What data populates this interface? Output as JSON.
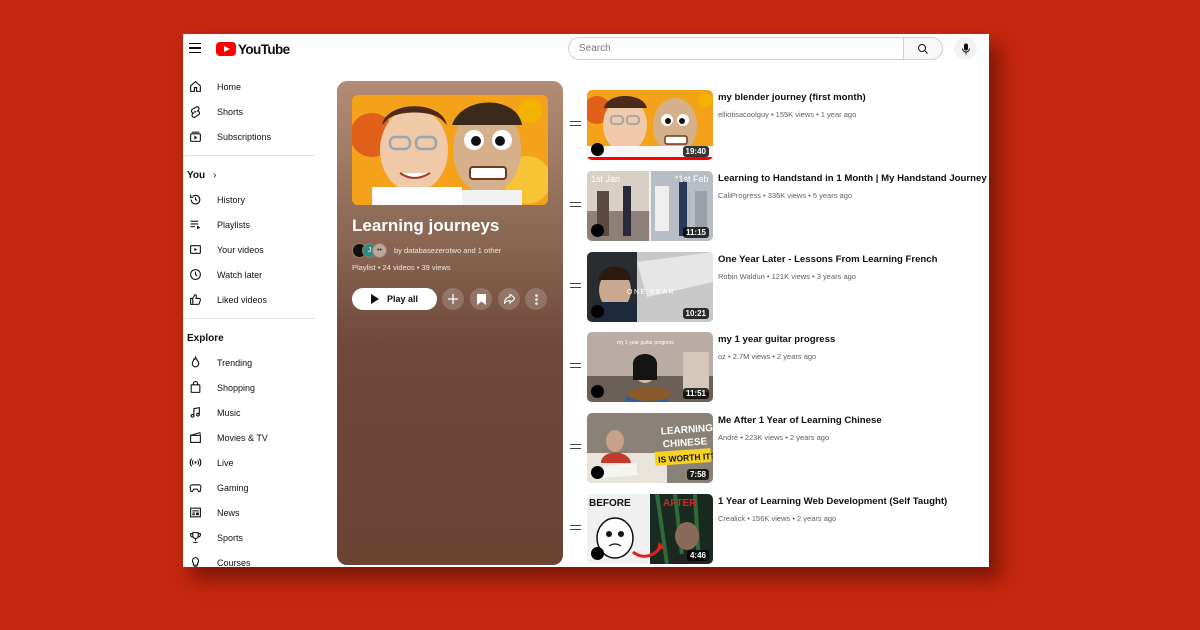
{
  "header": {
    "logo_text": "YouTube",
    "search_placeholder": "Search"
  },
  "sidebar": {
    "main": [
      {
        "label": "Home",
        "icon": "home-icon"
      },
      {
        "label": "Shorts",
        "icon": "shorts-icon"
      },
      {
        "label": "Subscriptions",
        "icon": "subscriptions-icon"
      }
    ],
    "you_heading": "You",
    "you": [
      {
        "label": "History",
        "icon": "history-icon"
      },
      {
        "label": "Playlists",
        "icon": "playlists-icon"
      },
      {
        "label": "Your videos",
        "icon": "your-videos-icon"
      },
      {
        "label": "Watch later",
        "icon": "watch-later-icon"
      },
      {
        "label": "Liked videos",
        "icon": "liked-icon"
      }
    ],
    "explore_heading": "Explore",
    "explore": [
      {
        "label": "Trending",
        "icon": "trending-icon"
      },
      {
        "label": "Shopping",
        "icon": "shopping-icon"
      },
      {
        "label": "Music",
        "icon": "music-icon"
      },
      {
        "label": "Movies & TV",
        "icon": "movies-icon"
      },
      {
        "label": "Live",
        "icon": "live-icon"
      },
      {
        "label": "Gaming",
        "icon": "gaming-icon"
      },
      {
        "label": "News",
        "icon": "news-icon"
      },
      {
        "label": "Sports",
        "icon": "sports-icon"
      },
      {
        "label": "Courses",
        "icon": "courses-icon"
      }
    ]
  },
  "playlist": {
    "title": "Learning journeys",
    "owners_text": "by databasezerotwo and 1 other",
    "avatar_letter": "J",
    "meta": "Playlist • 24 videos • 39 views",
    "play_all_label": "Play all",
    "colors": {
      "panel": "#70483a",
      "thumb_bg": "#f3a21a"
    }
  },
  "videos": [
    {
      "title": "my blender journey (first month)",
      "channel": "elliotisacoolguy",
      "meta": "elliotisacoolguy • 155K views • 1 year ago",
      "duration": "19:40",
      "watched_fraction": 1.0
    },
    {
      "title": "Learning to Handstand in 1 Month | My Handstand Journey",
      "channel": "CaliProgress",
      "meta": "CaliProgress • 336K views • 5 years ago",
      "duration": "11:15",
      "thumb_text_left": "1st Jan",
      "thumb_text_right": "*1st Feb"
    },
    {
      "title": "One Year Later - Lessons From Learning French",
      "channel": "Robin Waldun",
      "meta": "Robin Waldun • 121K views • 3 years ago",
      "duration": "10:21",
      "thumb_text": "ONE YEAR"
    },
    {
      "title": "my 1 year guitar progress",
      "channel": "oz",
      "meta": "oz • 2.7M views • 2 years ago",
      "duration": "11:51",
      "thumb_text": "my 1 year guitar progress"
    },
    {
      "title": "Me After 1 Year of Learning Chinese",
      "channel": "André",
      "meta": "André • 223K views • 2 years ago",
      "duration": "7:58",
      "thumb_text_1": "LEARNING",
      "thumb_text_2": "CHINESE",
      "thumb_text_3": "IS WORTH IT?"
    },
    {
      "title": "1 Year of Learning Web Development (Self Taught)",
      "channel": "Crealick",
      "meta": "Crealick • 156K views • 2 years ago",
      "duration": "4:46",
      "thumb_text_left": "BEFORE",
      "thumb_text_right": "AFTER"
    }
  ]
}
